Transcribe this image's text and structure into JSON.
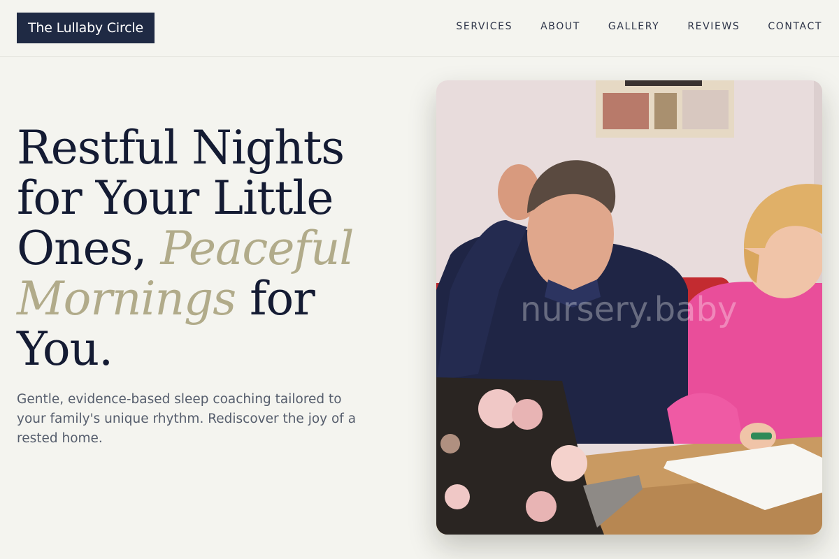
{
  "brand": {
    "name": "The Lullaby Circle"
  },
  "nav": {
    "items": [
      {
        "label": "SERVICES"
      },
      {
        "label": "ABOUT"
      },
      {
        "label": "GALLERY"
      },
      {
        "label": "REVIEWS"
      },
      {
        "label": "CONTACT"
      }
    ]
  },
  "hero": {
    "title_part1": "Restful Nights for Your Little Ones, ",
    "title_accent": "Peaceful Mornings",
    "title_part2": " for You.",
    "subtitle": "Gentle, evidence-based sleep coaching tailored to your family's unique rhythm. Rediscover the joy of a rested home.",
    "image": {
      "watermark": "nursery.baby"
    }
  },
  "colors": {
    "background": "#f4f4ef",
    "brand_dark": "#1f2a44",
    "accent": "#b1ab8a",
    "heading": "#141b33",
    "body_text": "#555d6c"
  }
}
